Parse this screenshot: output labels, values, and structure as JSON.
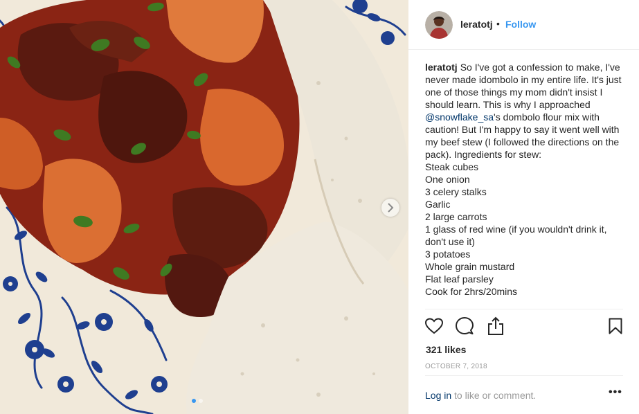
{
  "header": {
    "username": "leratotj",
    "separator": "•",
    "follow_label": "Follow"
  },
  "caption": {
    "username": "leratotj",
    "text_before_mention": "So I've got a confession to make, I've never made idombolo in my entire life. It's just one of those things my mom didn't insist I should learn. This is why I approached ",
    "mention": "@snowflake_sa",
    "text_after_mention": "'s dombolo flour mix with caution! But I'm happy to say it went well with my beef stew (I followed the directions on the pack). Ingredients for stew:",
    "ingredients": [
      "Steak cubes",
      "One onion",
      "3 celery stalks",
      "Garlic",
      "2 large carrots",
      "1 glass of red wine (if you wouldn't drink it, don't use it)",
      "3 potatoes",
      "Whole grain mustard",
      "Flat leaf parsley",
      "Cook for 2hrs/20mins"
    ]
  },
  "actions": {
    "like_icon": "heart-icon",
    "comment_icon": "comment-icon",
    "share_icon": "share-icon",
    "save_icon": "bookmark-icon"
  },
  "likes_text": "321 likes",
  "date_text": "OCTOBER 7, 2018",
  "comment_row": {
    "login_label": "Log in",
    "rest_text": " to like or comment.",
    "more_label": "•••"
  },
  "carousel": {
    "next_icon": "chevron-right-icon",
    "slides_total": 2,
    "active_slide": 1
  },
  "colors": {
    "accent": "#3897f0",
    "link_dark": "#003569",
    "text": "#262626",
    "muted": "#999999",
    "divider": "#efefef"
  }
}
